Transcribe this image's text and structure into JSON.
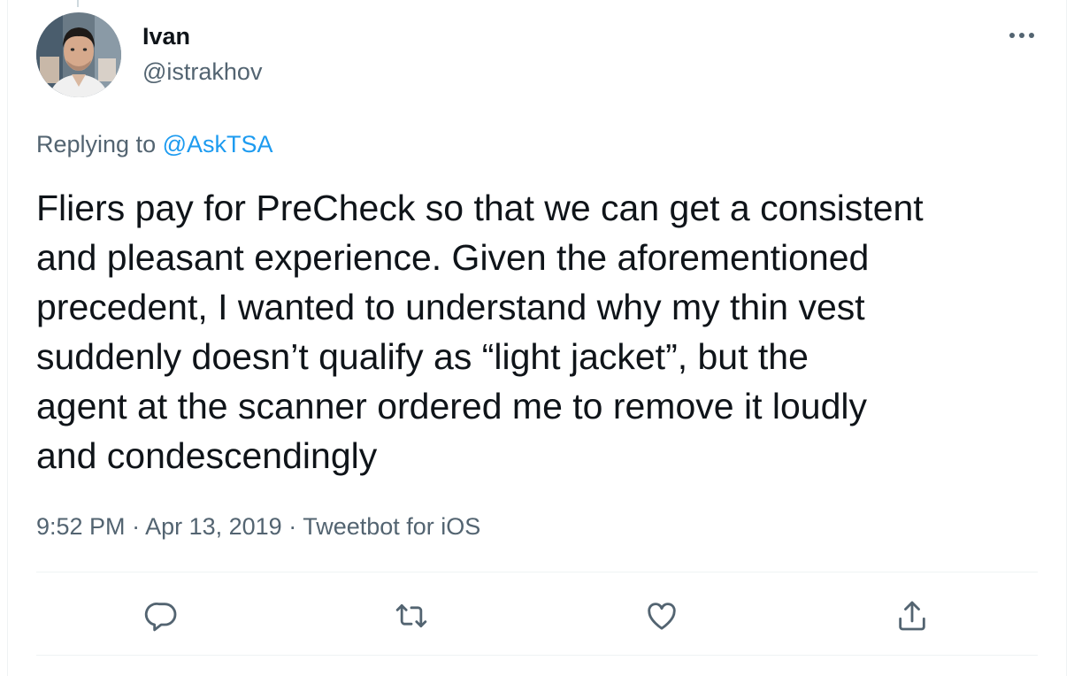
{
  "author": {
    "name": "Ivan",
    "handle": "@istrakhov"
  },
  "reply_context": {
    "prefix": "Replying to ",
    "mention": "@AskTSA"
  },
  "tweet": {
    "text": "Fliers pay for PreCheck so that we can get a consistent\nand pleasant experience. Given the aforementioned\nprecedent, I wanted to understand why my thin vest\nsuddenly doesn’t qualify as “light jacket”, but the\nagent at the scanner ordered me to remove it loudly\nand condescendingly"
  },
  "meta": {
    "time": "9:52 PM",
    "separator_1": " · ",
    "date": "Apr 13, 2019",
    "separator_2": " · ",
    "source": "Tweetbot for iOS"
  },
  "actions": [
    {
      "icon": "reply-icon"
    },
    {
      "icon": "retweet-icon"
    },
    {
      "icon": "like-icon"
    },
    {
      "icon": "share-icon"
    }
  ],
  "colors": {
    "text": "#0f1419",
    "secondary": "#536471",
    "accent": "#1d9bf0",
    "divider": "#eff3f4"
  }
}
